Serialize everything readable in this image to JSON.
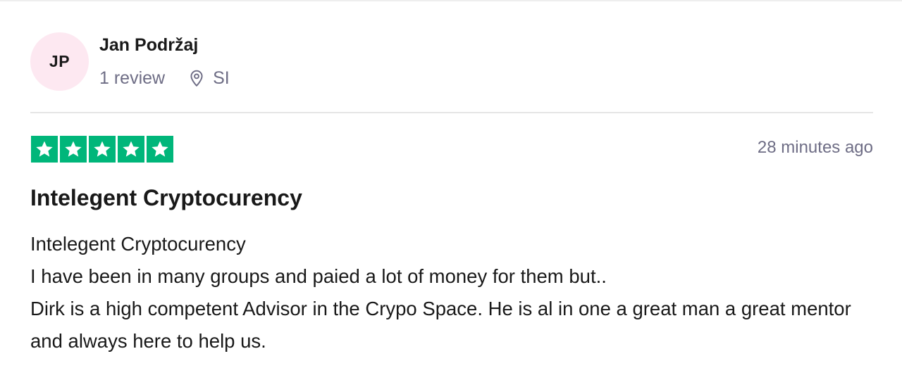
{
  "reviewer": {
    "initials": "JP",
    "name": "Jan Podržaj",
    "review_count": "1 review",
    "location_icon": "location-pin-icon",
    "country": "SI"
  },
  "review": {
    "rating": 5,
    "max_rating": 5,
    "star_color": "#00b67a",
    "date": "28 minutes ago",
    "title": "Intelegent Cryptocurency",
    "lines": [
      "Intelegent Cryptocurency",
      "I have been in many groups and paied a lot of money for them but..",
      "Dirk is a high competent Advisor in the Crypo Space. He is al in one a great man a great mentor and always here to help us."
    ]
  },
  "colors": {
    "avatar_bg": "#fde8f1",
    "muted_text": "#6e6d85",
    "text": "#191919"
  }
}
